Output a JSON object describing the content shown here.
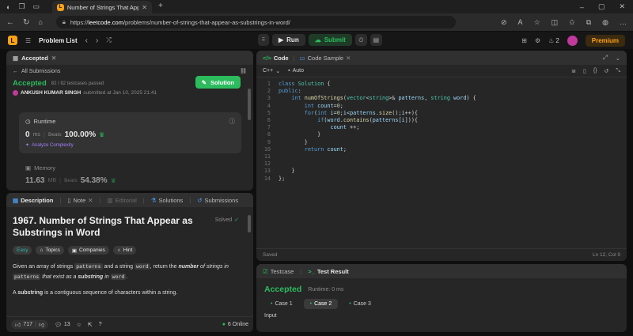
{
  "browser": {
    "tab_title": "Number of Strings That Appear as",
    "url_prefix": "https://",
    "url_host": "leetcode.com",
    "url_path": "/problems/number-of-strings-that-appear-as-substrings-in-word/"
  },
  "nav": {
    "problem_list": "Problem List",
    "run": "Run",
    "submit": "Submit",
    "streak": "2",
    "premium": "Premium"
  },
  "submission": {
    "tab_label": "Accepted",
    "back_link": "All Submissions",
    "status": "Accepted",
    "testcases": "82 / 82 testcases passed",
    "user": "ANKUSH KUMAR SINGH",
    "submitted": "submitted at Jan 10, 2025 21:41",
    "solution_btn": "Solution",
    "runtime_label": "Runtime",
    "runtime_value": "0",
    "runtime_unit": "ms",
    "beats_label": "Beats",
    "runtime_beats": "100.00%",
    "analyze": "Analyze Complexity",
    "memory_label": "Memory",
    "memory_value": "11.63",
    "memory_unit": "MB",
    "memory_beats": "54.38%"
  },
  "desc_tabs": [
    "Description",
    "Note",
    "Editorial",
    "Solutions",
    "Submissions"
  ],
  "problem": {
    "title_line1": "1967. Number of Strings That Appear as",
    "title_line2": "Substrings in Word",
    "solved": "Solved",
    "tags": [
      "Easy",
      "Topics",
      "Companies",
      "Hint"
    ],
    "p1_a": "Given an array of strings ",
    "p1_code1": "patterns",
    "p1_b": " and a string ",
    "p1_code2": "word",
    "p1_c": ", return the ",
    "p1_d": "number",
    "p1_e": " of strings in",
    "p1_code3": "patterns",
    "p1_f": " that exist as a ",
    "p1_g": "substring",
    "p1_h": " in ",
    "p1_code4": "word",
    "p1_i": ".",
    "p2_a": "A ",
    "p2_b": "substring",
    "p2_c": " is a contiguous sequence of characters within a string.",
    "likes": "717",
    "comments": "13",
    "online": "6 Online"
  },
  "editor": {
    "tab_code": "Code",
    "tab_sample": "Code Sample",
    "language": "C++",
    "auto": "Auto",
    "lines": [
      "class Solution {",
      "public:",
      "    int numOfStrings(vector<string>& patterns, string word) {",
      "        int count=0;",
      "        for(int i=0;i<patterns.size();i++){",
      "            if(word.contains(patterns[i])){",
      "                count ++;",
      "            }",
      "        }",
      "        return count;",
      "",
      "",
      "    }",
      "};"
    ],
    "saved": "Saved",
    "cursor": "Ln 12, Col 9"
  },
  "result": {
    "tab_testcase": "Testcase",
    "tab_result": "Test Result",
    "status": "Accepted",
    "runtime": "Runtime: 0 ms",
    "cases": [
      "Case 1",
      "Case 2",
      "Case 3"
    ],
    "input_label": "Input"
  },
  "colors": {
    "accent": "#ffa116",
    "success": "#2cbb5d",
    "panel": "#262626"
  }
}
